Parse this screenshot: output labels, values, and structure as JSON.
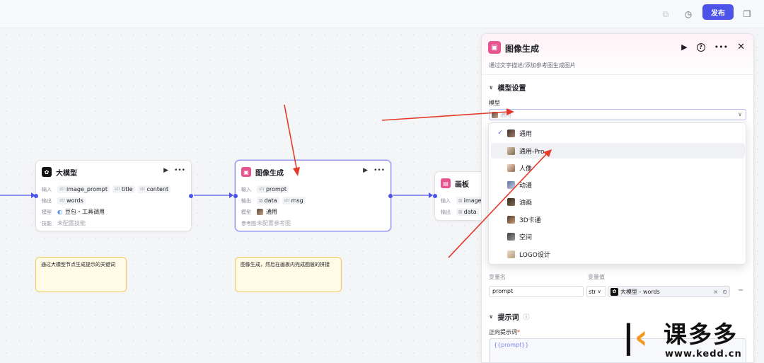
{
  "topbar": {
    "publish_label": "发布"
  },
  "nodes": {
    "llm": {
      "title": "大模型",
      "input_label": "输入",
      "inputs": [
        {
          "type": "str",
          "name": "image_prompt"
        },
        {
          "type": "str",
          "name": "title"
        },
        {
          "type": "str",
          "name": "content"
        }
      ],
      "output_label": "输出",
      "outputs": [
        {
          "type": "str",
          "name": "words"
        }
      ],
      "model_label": "模型",
      "model_value": "豆包・工具调用",
      "skill_label": "技能",
      "skill_value": "未配置技能"
    },
    "image_gen": {
      "title": "图像生成",
      "input_label": "输入",
      "inputs": [
        {
          "type": "str",
          "name": "prompt"
        }
      ],
      "output_label": "输出",
      "outputs": [
        {
          "type": "",
          "name": "data"
        },
        {
          "type": "str",
          "name": "msg"
        }
      ],
      "model_label": "模型",
      "model_value": "通用",
      "ref_label": "参考图",
      "ref_value": "未配置参考图"
    },
    "canvas": {
      "title": "画板",
      "input_label": "输入",
      "inputs": [
        {
          "type": "",
          "name": "image"
        }
      ],
      "output_label": "输出",
      "outputs": [
        {
          "type": "",
          "name": "data"
        }
      ]
    }
  },
  "notes": [
    "通过大模型节点生成提示的关键词",
    "图像生成，然后在画板内完成图层的拼接"
  ],
  "panel": {
    "title": "图像生成",
    "description": "通过文字描述/添加参考图生成图片",
    "model_section": "模型设置",
    "model_label": "模型",
    "model_current": "通用",
    "var_name_header": "变量名",
    "var_value_header": "变量值",
    "var_name": "prompt",
    "var_type": "str",
    "var_ref": "大模型 - words",
    "prompt_section": "提示词",
    "positive_prompt_label": "正向提示词",
    "positive_prompt_value": "{{prompt}}"
  },
  "dropdown": {
    "options": [
      "通用",
      "通用-Pro",
      "人像",
      "动漫",
      "油画",
      "3D卡通",
      "空间",
      "LOGO设计"
    ],
    "selected_index": 0,
    "hover_index": 1
  },
  "watermark": {
    "name": "课多多",
    "url": "www.kedd.cn"
  },
  "colors": {
    "accent": "#4d53e8",
    "image_node": "#e8548f",
    "annotation_arrow": "#e53a2a",
    "note_border": "#f0c75a"
  }
}
